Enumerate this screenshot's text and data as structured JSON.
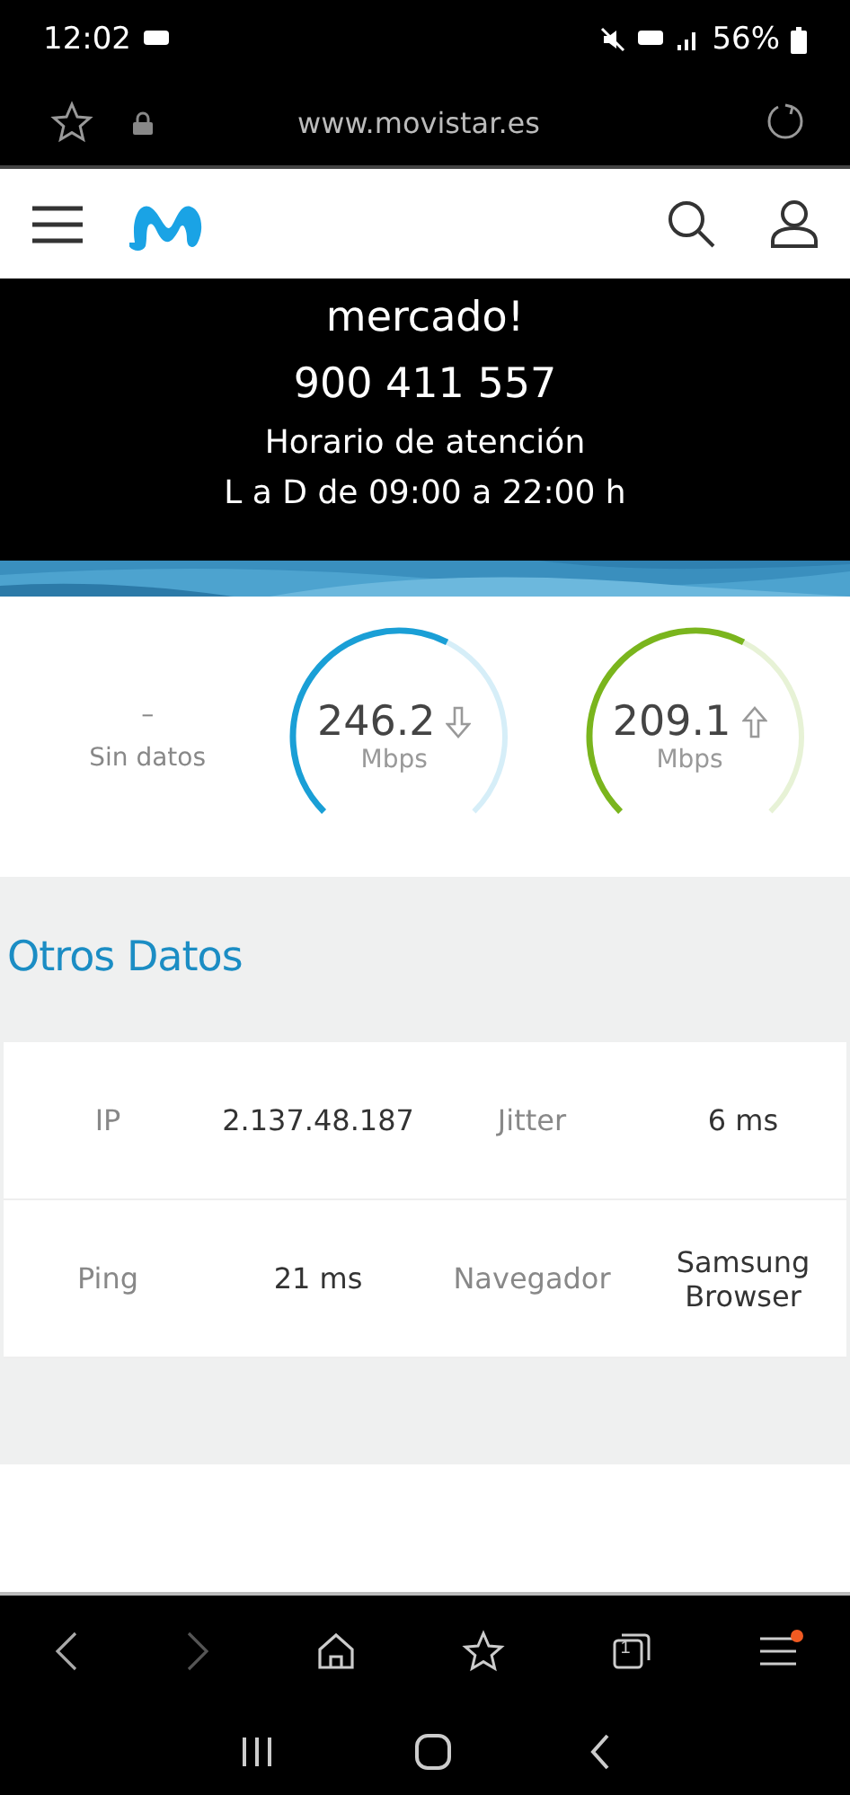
{
  "status_bar": {
    "time": "12:02",
    "battery": "56%"
  },
  "url_bar": {
    "url": "www.movistar.es"
  },
  "promo": {
    "lines": [
      "mercado!",
      "900 411 557",
      "Horario de atención",
      "L a D de 09:00 a 22:00 h"
    ]
  },
  "speed": {
    "ping": {
      "value": "–",
      "label": "Sin datos"
    },
    "gauges": [
      {
        "value": "246.2",
        "unit": "Mbps",
        "kind": "download",
        "color": "#1a9fd6"
      },
      {
        "value": "209.1",
        "unit": "Mbps",
        "kind": "upload",
        "color": "#7ab51d"
      }
    ]
  },
  "other_data": {
    "title": "Otros Datos",
    "rows": [
      [
        "IP",
        "2.137.48.187",
        "Jitter",
        "6 ms"
      ],
      [
        "Ping",
        "21 ms",
        "Navegador",
        "Samsung Browser"
      ]
    ]
  },
  "browser_nav": {
    "forward_disabled": true,
    "tab_count": "1",
    "menu_badge": true
  }
}
